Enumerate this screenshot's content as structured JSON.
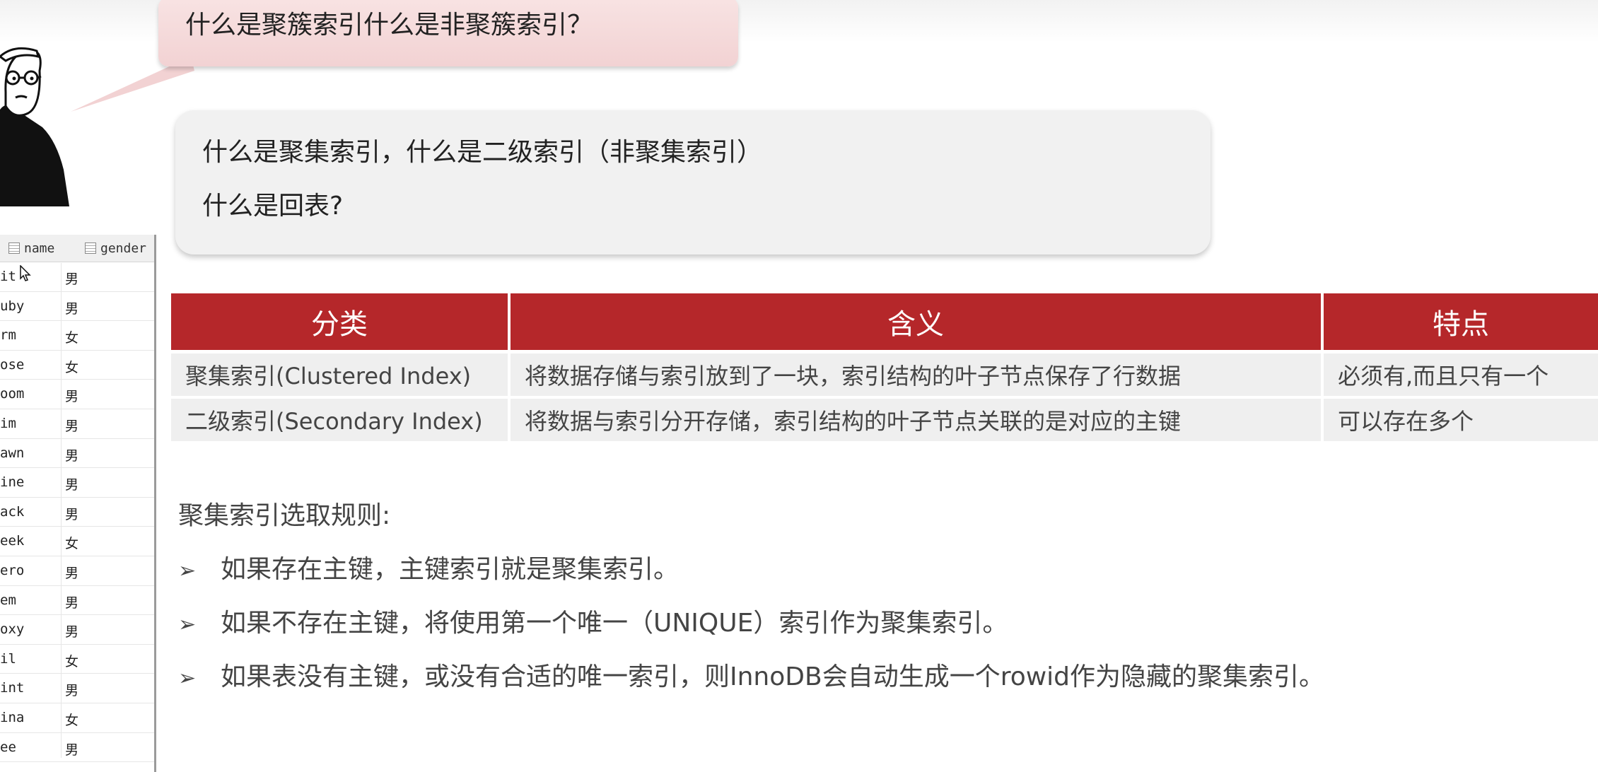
{
  "bubble": {
    "question": "什么是聚簇索引什么是非聚簇索引？"
  },
  "card": {
    "line1": "什么是聚集索引，什么是二级索引（非聚集索引）",
    "line2": "什么是回表?"
  },
  "left_table": {
    "headers": [
      "name",
      "gender"
    ],
    "rows": [
      [
        "it",
        "男"
      ],
      [
        "uby",
        "男"
      ],
      [
        "rm",
        "女"
      ],
      [
        "ose",
        "女"
      ],
      [
        "oom",
        "男"
      ],
      [
        "im",
        "男"
      ],
      [
        "awn",
        "男"
      ],
      [
        "ine",
        "男"
      ],
      [
        "ack",
        "男"
      ],
      [
        "eek",
        "女"
      ],
      [
        "ero",
        "男"
      ],
      [
        "em",
        "男"
      ],
      [
        "oxy",
        "男"
      ],
      [
        "il",
        "女"
      ],
      [
        "int",
        "男"
      ],
      [
        "ina",
        "女"
      ],
      [
        "ee",
        "男"
      ]
    ]
  },
  "main_table": {
    "headers": [
      "分类",
      "含义",
      "特点"
    ],
    "rows": [
      [
        "聚集索引(Clustered Index)",
        "将数据存储与索引放到了一块，索引结构的叶子节点保存了行数据",
        "必须有,而且只有一个"
      ],
      [
        "二级索引(Secondary Index)",
        "将数据与索引分开存储，索引结构的叶子节点关联的是对应的主键",
        "可以存在多个"
      ]
    ],
    "header_color": "#b5272a"
  },
  "rules": {
    "title": "聚集索引选取规则:",
    "items": [
      "如果存在主键，主键索引就是聚集索引。",
      "如果不存在主键，将使用第一个唯一（UNIQUE）索引作为聚集索引。",
      "如果表没有主键，或没有合适的唯一索引，则InnoDB会自动生成一个rowid作为隐藏的聚集索引。"
    ]
  }
}
